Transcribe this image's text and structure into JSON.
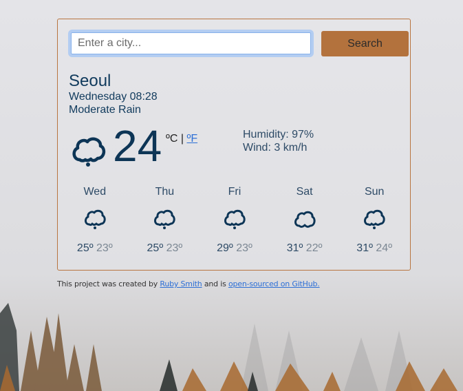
{
  "search": {
    "placeholder": "Enter a city...",
    "value": "",
    "button_label": "Search"
  },
  "current": {
    "city": "Seoul",
    "datetime": "Wednesday 08:28",
    "description": "Moderate Rain",
    "icon": "rain-cloud-icon",
    "temperature": "24",
    "unit_celsius": "ºC",
    "unit_separator": "|",
    "unit_fahrenheit": "ºF",
    "humidity": "Humidity: 97%",
    "wind": "Wind: 3 km/h"
  },
  "forecast": [
    {
      "day": "Wed",
      "icon": "rain-cloud-icon",
      "max": "25º",
      "min": "23º"
    },
    {
      "day": "Thu",
      "icon": "rain-cloud-icon",
      "max": "25º",
      "min": "23º"
    },
    {
      "day": "Fri",
      "icon": "rain-cloud-icon",
      "max": "29º",
      "min": "23º"
    },
    {
      "day": "Sat",
      "icon": "cloud-icon",
      "max": "31º",
      "min": "22º"
    },
    {
      "day": "Sun",
      "icon": "rain-cloud-icon",
      "max": "31º",
      "min": "24º"
    }
  ],
  "footer": {
    "prefix": "This project was created by",
    "author_link": "Ruby Smith",
    "middle": "and is",
    "repo_link": "open-sourced on GitHub."
  },
  "colors": {
    "accent": "#b3723d",
    "text_primary": "#103a5c",
    "link": "#2c6fd6"
  }
}
